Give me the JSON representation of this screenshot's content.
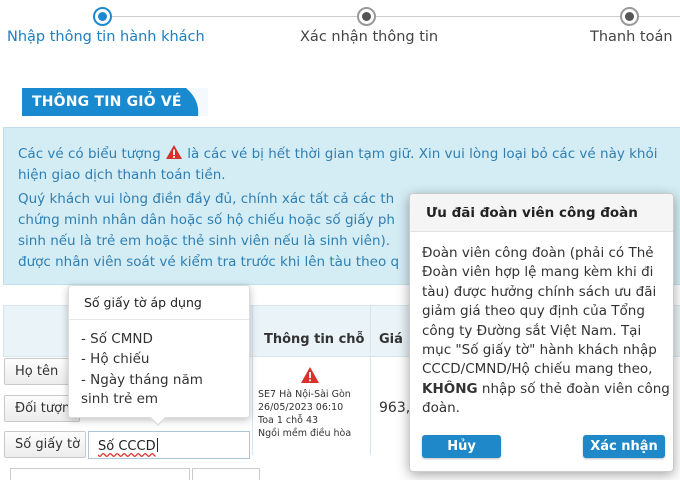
{
  "stepper": {
    "steps": [
      {
        "label": "Nhập thông tin hành khách",
        "active": true
      },
      {
        "label": "Xác nhận thông tin",
        "active": false
      },
      {
        "label": "Thanh toán",
        "active": false
      }
    ]
  },
  "section": {
    "title": "THÔNG TIN GIỎ VÉ"
  },
  "notice": {
    "p1_before": "Các vé có biểu tượng",
    "p1_after": "là các vé bị hết thời gian tạm giữ. Xin vui lòng loại bỏ các vé này khỏi",
    "p1_line2": "hiện giao dịch thanh toán tiền.",
    "p2_line1": "Quý khách vui lòng điền đầy đủ, chính xác tất cả các th",
    "p2_line2": "chứng minh nhân dân hoặc số hộ chiếu hoặc số giấy ph",
    "p2_line3": "sinh nếu là trẻ em hoặc thẻ sinh viên nếu là sinh viên).",
    "p2_line4": "được nhân viên soát vé kiểm tra trước khi lên tàu theo q"
  },
  "table": {
    "headers": {
      "seat": "Thông tin chỗ",
      "price": "Giá"
    },
    "row_labels": {
      "name": "Họ tên",
      "type": "Đối tượng",
      "id": "Số giấy tờ"
    },
    "id_value": "Số CCCD",
    "seat_info": [
      "SE7 Hà Nội-Sài Gòn",
      "26/05/2023 06:10",
      "Toa 1 chỗ 43",
      "Ngồi mềm điều hòa"
    ],
    "price": "963,"
  },
  "tooltip": {
    "title": "Số giấy tờ áp dụng",
    "items": [
      "- Số CMND",
      "- Hộ chiếu",
      "- Ngày tháng năm",
      "sinh trẻ em"
    ]
  },
  "popover": {
    "title": "Ưu đãi đoàn viên công đoàn",
    "body_before": "Đoàn viên công đoàn (phải có Thẻ Đoàn viên hợp lệ mang kèm khi đi tàu) được hưởng chính sách ưu đãi giảm giá theo quy định của Tổng công ty Đường sắt Việt Nam. Tại mục \"Số giấy tờ\" hành khách nhập CCCD/CMND/Hộ chiếu mang theo,",
    "body_bold": "KHÔNG",
    "body_after": "nhập số thẻ đoàn viên công đoàn.",
    "cancel_label": "Hủy",
    "confirm_label": "Xác nhận"
  },
  "colors": {
    "primary": "#1a8ad0",
    "notice_bg": "#d4edf5",
    "notice_text": "#2f7fb2",
    "warning": "#d9302c"
  },
  "icons": {
    "warning": "warning-triangle-icon"
  }
}
